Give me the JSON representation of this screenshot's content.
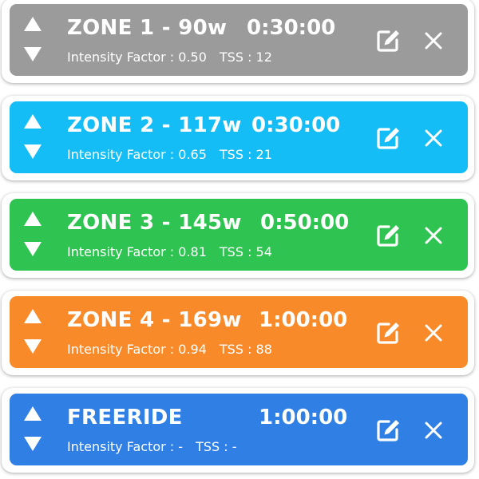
{
  "icons": {
    "move_up": "triangle-up-icon",
    "move_down": "triangle-down-icon",
    "edit": "edit-square-pencil-icon",
    "delete": "close-x-icon"
  },
  "colors": {
    "zone1": "#9b9b9b",
    "zone2": "#14bdf5",
    "zone3": "#2fc451",
    "zone4": "#f98a2a",
    "freeride": "#2f7fe4",
    "text": "#ffffff"
  },
  "labels": {
    "intensity_prefix": "Intensity Factor : ",
    "tss_prefix": "TSS : "
  },
  "segments": [
    {
      "title": "ZONE 1 - 90w",
      "duration": "0:30:00",
      "intensity_factor": "0.50",
      "tss": "12"
    },
    {
      "title": "ZONE 2 - 117w",
      "duration": "0:30:00",
      "intensity_factor": "0.65",
      "tss": "21"
    },
    {
      "title": "ZONE 3 - 145w",
      "duration": "0:50:00",
      "intensity_factor": "0.81",
      "tss": "54"
    },
    {
      "title": "ZONE 4 - 169w",
      "duration": "1:00:00",
      "intensity_factor": "0.94",
      "tss": "88"
    },
    {
      "title": "FREERIDE",
      "duration": "1:00:00",
      "intensity_factor": "-",
      "tss": "-"
    }
  ]
}
